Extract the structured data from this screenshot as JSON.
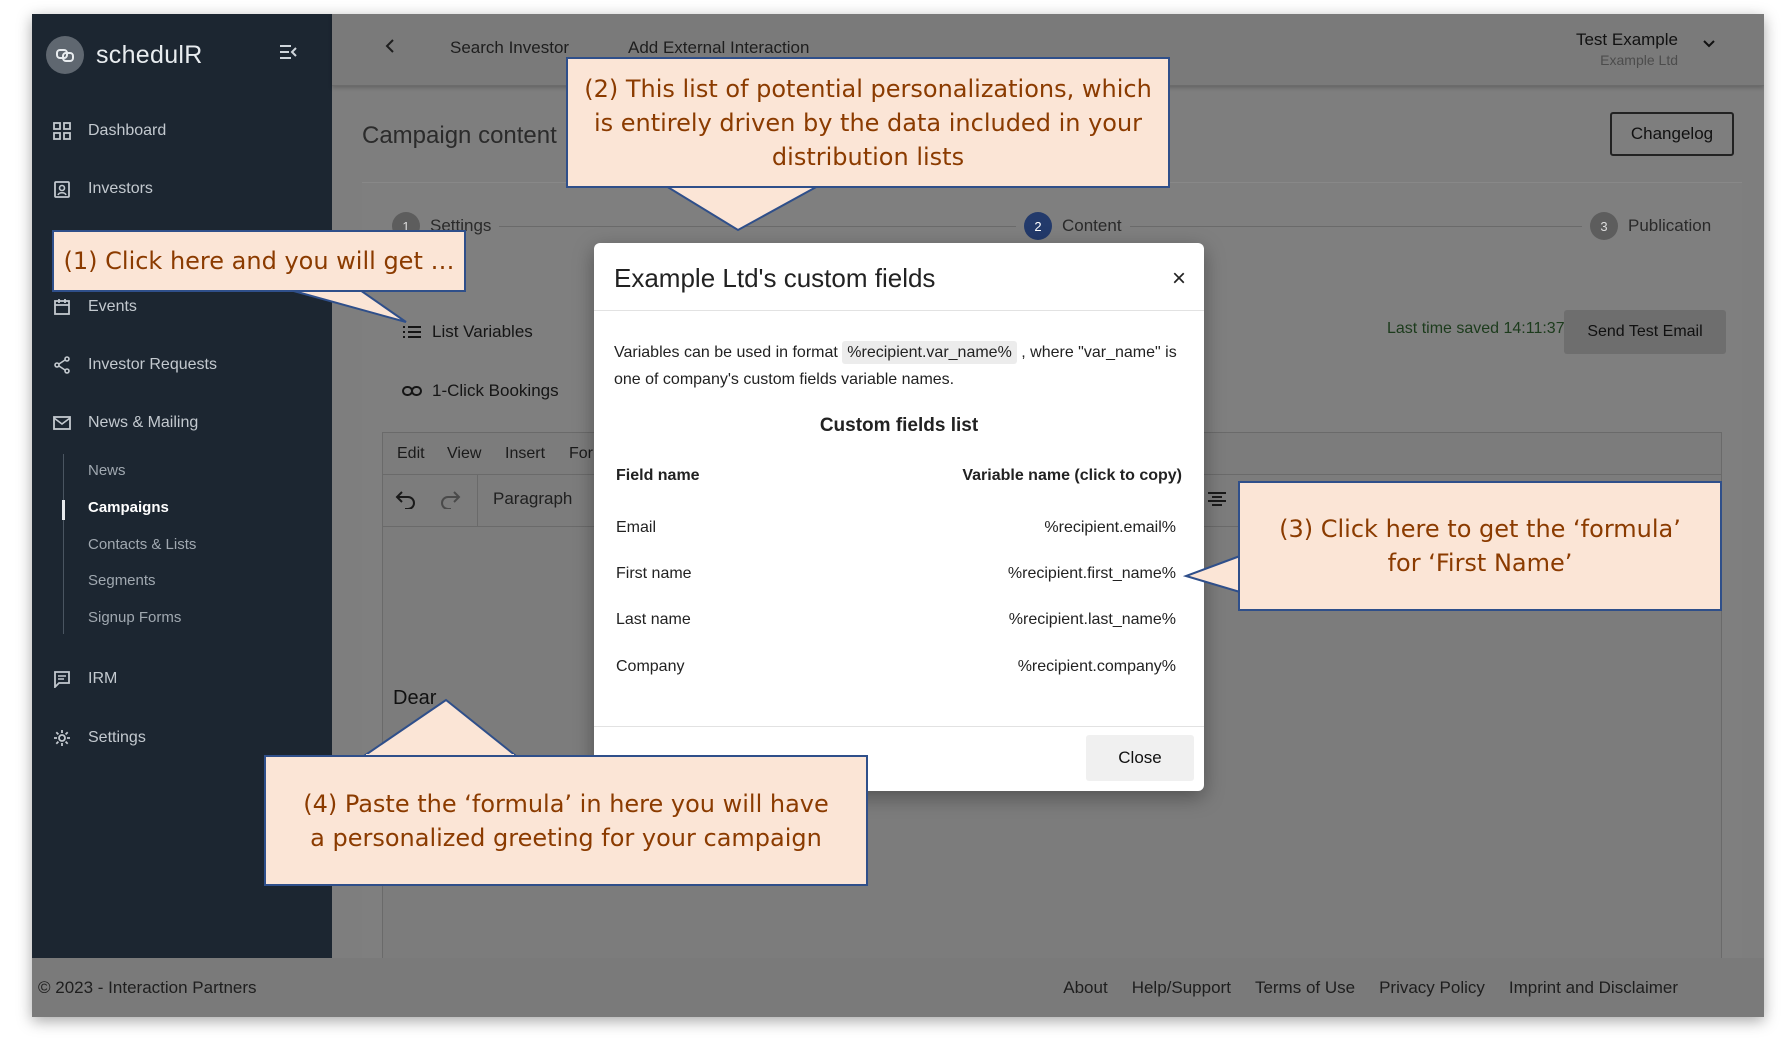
{
  "app": {
    "name": "schedulR"
  },
  "sidebar": {
    "items": [
      {
        "label": "Dashboard",
        "icon": "dashboard-icon"
      },
      {
        "label": "Investors",
        "icon": "investors-icon"
      },
      {
        "label": "Events",
        "icon": "calendar-icon"
      },
      {
        "label": "Investor Requests",
        "icon": "share-icon"
      },
      {
        "label": "News & Mailing",
        "icon": "mail-icon"
      },
      {
        "label": "IRM",
        "icon": "irm-icon"
      },
      {
        "label": "Settings",
        "icon": "gear-icon"
      }
    ],
    "subitems": [
      "News",
      "Campaigns",
      "Contacts & Lists",
      "Segments",
      "Signup Forms"
    ],
    "active_subitem": "Campaigns"
  },
  "topbar": {
    "back_icon": "chevron-left-icon",
    "links": [
      "Search Investor",
      "Add External Interaction"
    ],
    "user_name": "Test Example",
    "user_company": "Example Ltd"
  },
  "page": {
    "title": "Campaign content",
    "changelog_label": "Changelog",
    "steps": [
      {
        "num": "1",
        "label": "Settings"
      },
      {
        "num": "2",
        "label": "Content"
      },
      {
        "num": "3",
        "label": "Publication"
      }
    ],
    "list_variables_label": "List Variables",
    "bookings_label": "1-Click Bookings",
    "saved_text": "Last time saved 14:11:37",
    "send_test_label": "Send Test Email",
    "editor_menu": [
      "Edit",
      "View",
      "Insert",
      "For"
    ],
    "block_format": "Paragraph",
    "editor_text": "Dear"
  },
  "modal": {
    "title": "Example Ltd's custom fields",
    "desc_1": "Variables can be used in format",
    "desc_code": "%recipient.var_name%",
    "desc_2": ", where \"var_name\" is one of company's custom fields variable names.",
    "list_title": "Custom fields list",
    "col_field": "Field name",
    "col_variable": "Variable name (click to copy)",
    "rows": [
      {
        "field": "Email",
        "variable": "%recipient.email%"
      },
      {
        "field": "First name",
        "variable": "%recipient.first_name%"
      },
      {
        "field": "Last name",
        "variable": "%recipient.last_name%"
      },
      {
        "field": "Company",
        "variable": "%recipient.company%"
      }
    ],
    "close_label": "Close"
  },
  "callouts": {
    "c1": "(1) Click here and you will get …",
    "c2": "(2) This list of potential personalizations, which is entirely driven by the data included in your distribution lists",
    "c3": "(3) Click here to get the ‘formula’ for ‘First Name’",
    "c4": "(4) Paste the ‘formula’ in here you will have a personalized greeting for your campaign"
  },
  "footer": {
    "copyright": "© 2023 - Interaction Partners",
    "links": [
      "About",
      "Help/Support",
      "Terms of Use",
      "Privacy Policy",
      "Imprint and Disclaimer"
    ]
  },
  "colors": {
    "sidebar_bg": "#1c2631",
    "step_active": "#233a6b",
    "callout_bg": "#fbe5d6",
    "callout_border": "#2f4f8a",
    "callout_text": "#8b3b00"
  }
}
